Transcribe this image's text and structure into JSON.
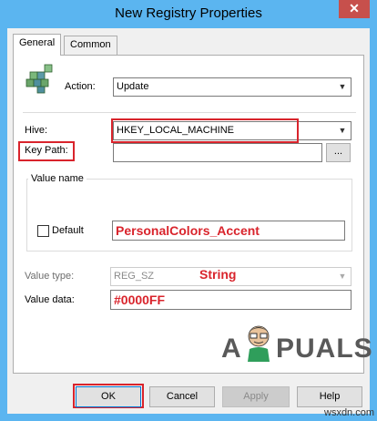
{
  "window": {
    "title": "New Registry Properties",
    "close_glyph": "✕"
  },
  "tabs": [
    {
      "label": "General"
    },
    {
      "label": "Common"
    }
  ],
  "form": {
    "action_label": "Action:",
    "action_value": "Update",
    "hive_label": "Hive:",
    "hive_value": "HKEY_LOCAL_MACHINE",
    "keypath_label": "Key Path:",
    "keypath_value": "",
    "browse_label": "...",
    "value_name_group": "Value name",
    "default_label": "Default",
    "value_name_value": "PersonalColors_Accent",
    "value_type_label": "Value type:",
    "value_type_value": "REG_SZ",
    "value_type_annotation": "String",
    "value_data_label": "Value data:",
    "value_data_value": "#0000FF"
  },
  "buttons": {
    "ok": "OK",
    "cancel": "Cancel",
    "apply": "Apply",
    "help": "Help"
  },
  "watermark": {
    "left": "A",
    "right": "PUALS",
    "site": "wsxdn.com"
  },
  "colors": {
    "titlebar": "#5bb5f0",
    "annotation_red": "#d9242c",
    "close": "#c7504c"
  },
  "icons": {
    "registry": "registry-cubes-icon",
    "dropdown": "chevron-down-icon"
  }
}
